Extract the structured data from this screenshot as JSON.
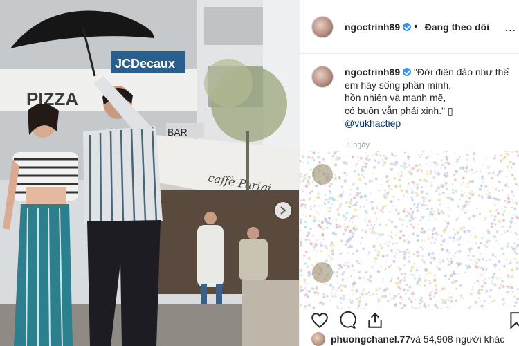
{
  "post": {
    "author": "ngoctrinh89",
    "follow_separator": "•",
    "follow_status": "Đang theo dõi",
    "more_menu": "...",
    "caption_lines": [
      "\"Đời điên đảo như thế",
      "em hãy sống phần mình,",
      "hồn nhiên và mạnh mẽ,",
      "có buồn vẫn phải xinh.\" ▯"
    ],
    "mention": "@vukhactiep",
    "timestamp": "1 ngày"
  },
  "photo_text": {
    "billboard": "JCDecaux",
    "awning": "caffè Parigi",
    "sign_left": "PIZZA",
    "sign_bar": "BAR"
  },
  "likes": {
    "first_liker": "phuongchanel.77",
    "rest": " và 54,908 người khác"
  },
  "icons": [
    "heart-icon",
    "comment-icon",
    "share-icon",
    "bookmark-icon",
    "chevron-right-icon",
    "verified-badge-icon"
  ],
  "colors": {
    "verified": "#3897f0",
    "mention": "#003569",
    "timestamp": "#999999",
    "border": "#efefef"
  }
}
